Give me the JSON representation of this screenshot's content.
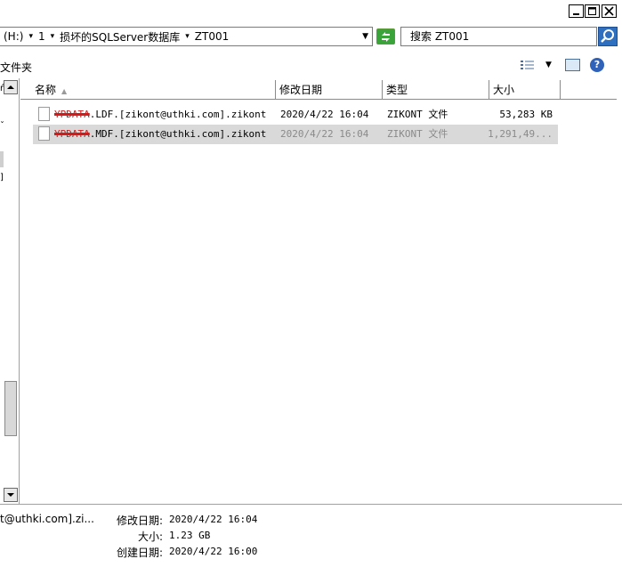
{
  "address": {
    "crumbs": [
      "(H:)",
      "1",
      "损坏的SQLServer数据库",
      "ZT001"
    ]
  },
  "search": {
    "value": "搜索 ZT001"
  },
  "toolbar": {
    "folder_label": "文件夹"
  },
  "columns": {
    "name": "名称",
    "date": "修改日期",
    "type": "类型",
    "size": "大小"
  },
  "files": [
    {
      "name_redacted": "YPDATA",
      "name_rest": ".LDF.[zikont@uthki.com].zikont",
      "date": "2020/4/22 16:04",
      "type": "ZIKONT 文件",
      "size": "53,283 KB",
      "selected": false
    },
    {
      "name_redacted": "YPDATA",
      "name_rest": ".MDF.[zikont@uthki.com].zikont",
      "date": "2020/4/22 16:04",
      "type": "ZIKONT 文件",
      "size": "1,291,49...",
      "selected": true
    }
  ],
  "details": {
    "name": "t@uthki.com].zi...",
    "modified_label": "修改日期:",
    "modified_value": "2020/4/22 16:04",
    "size_label": "大小:",
    "size_value": "1.23 GB",
    "created_label": "创建日期:",
    "created_value": "2020/4/22 16:00"
  },
  "icons": {
    "minimize": "minimize-icon",
    "maximize": "maximize-icon",
    "close": "close-icon",
    "refresh": "refresh-icon",
    "search": "search-icon",
    "views": "views-icon",
    "preview_pane": "preview-pane-icon",
    "help": "help-icon",
    "file": "file-icon"
  }
}
